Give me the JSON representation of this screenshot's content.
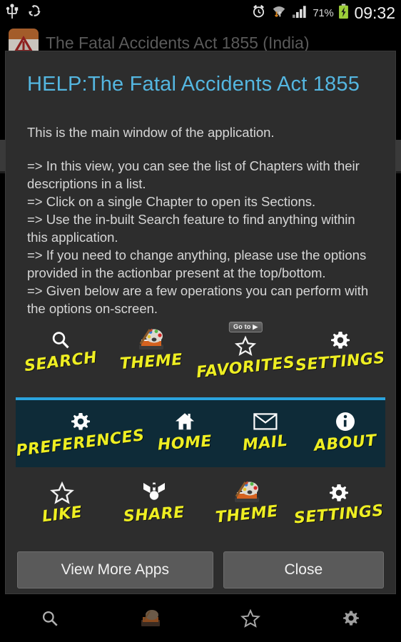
{
  "status_bar": {
    "left_icons": [
      "usb-icon",
      "sync-recycle-icon"
    ],
    "right_icons": [
      "alarm-icon",
      "wifi-transfer-icon",
      "signal-bars-icon",
      "battery-charging-icon"
    ],
    "battery_percent": "71%",
    "clock": "09:32"
  },
  "app": {
    "title": "The Fatal Accidents Act 1855 (India)",
    "icon": "warning-triangle-app-icon"
  },
  "dialog": {
    "title": "HELP:The Fatal Accidents Act 1855",
    "accent_color": "#3d9bd0",
    "title_color": "#54b6e0",
    "body": [
      "This is the main window of the application.",
      "",
      " => In this view, you can see the list of Chapters with their descriptions in a list.",
      " => Click on a single Chapter to open its Sections.",
      " => Use the in-built Search feature to find anything within this application.",
      " => If you need to change anything, please use the options provided in the actionbar present at the top/bottom.",
      " => Given below are a few operations you can perform with the options on-screen."
    ],
    "label_color": "#eeee22",
    "rows": [
      {
        "highlighted": false,
        "items": [
          {
            "label": "SEARCH",
            "icon": "search-icon"
          },
          {
            "label": "THEME",
            "icon": "palette-theme-icon"
          },
          {
            "label": "FAVORITES",
            "icon": "star-outline-icon",
            "badge": "Go to ▶"
          },
          {
            "label": "SETTINGS",
            "icon": "gear-icon"
          }
        ]
      },
      {
        "highlighted": true,
        "background": "#0e2b38",
        "border_color": "#2aa3dd",
        "items": [
          {
            "label": "PREFERENCES",
            "icon": "gear-icon"
          },
          {
            "label": "HOME",
            "icon": "home-icon"
          },
          {
            "label": "MAIL",
            "icon": "envelope-icon"
          },
          {
            "label": "ABOUT",
            "icon": "info-circle-icon"
          }
        ]
      },
      {
        "highlighted": false,
        "items": [
          {
            "label": "LIKE",
            "icon": "star-outline-icon"
          },
          {
            "label": "SHARE",
            "icon": "share-nodes-icon"
          },
          {
            "label": "THEME",
            "icon": "palette-theme-icon"
          },
          {
            "label": "SETTINGS",
            "icon": "gear-icon"
          }
        ]
      }
    ],
    "buttons": {
      "view_more_apps": "View More Apps",
      "close": "Close"
    }
  },
  "bottom_bar": {
    "items": [
      "search-icon",
      "palette-theme-icon",
      "star-outline-icon",
      "gear-icon"
    ]
  }
}
